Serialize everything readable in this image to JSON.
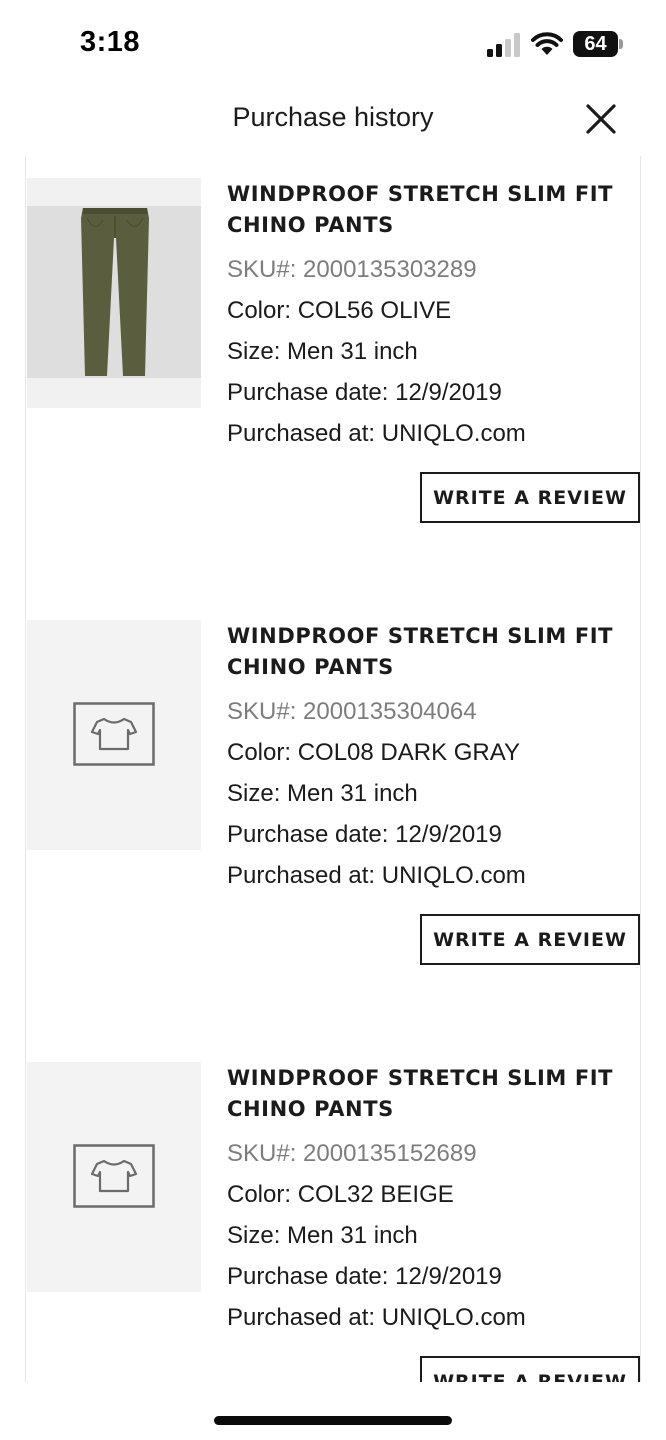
{
  "status_bar": {
    "time": "3:18",
    "battery": "64",
    "icons": [
      "signal-icon",
      "wifi-icon",
      "battery-icon"
    ]
  },
  "header": {
    "title": "Purchase history",
    "close_icon": "close-icon"
  },
  "items": [
    {
      "name": "WINDPROOF STRETCH SLIM FIT CHINO PANTS",
      "sku": "SKU#: 2000135303289",
      "color": "Color: COL56 OLIVE",
      "size": "Size: Men 31 inch",
      "purchase_date": "Purchase date: 12/9/2019",
      "purchased_at": "Purchased at: UNIQLO.com",
      "image": "olive-pants-photo",
      "review_label": "WRITE A REVIEW"
    },
    {
      "name": "WINDPROOF STRETCH SLIM FIT CHINO PANTS",
      "sku": "SKU#: 2000135304064",
      "color": "Color: COL08 DARK GRAY",
      "size": "Size: Men 31 inch",
      "purchase_date": "Purchase date: 12/9/2019",
      "purchased_at": "Purchased at: UNIQLO.com",
      "image": "tshirt-placeholder-icon",
      "review_label": "WRITE A REVIEW"
    },
    {
      "name": "WINDPROOF STRETCH SLIM FIT CHINO PANTS",
      "sku": "SKU#: 2000135152689",
      "color": "Color: COL32 BEIGE",
      "size": "Size: Men 31 inch",
      "purchase_date": "Purchase date: 12/9/2019",
      "purchased_at": "Purchased at: UNIQLO.com",
      "image": "tshirt-placeholder-icon",
      "review_label": "WRITE A REVIEW"
    }
  ],
  "colors": {
    "text": "#1b1b1b",
    "sku_text": "#7d7d7d",
    "thumb_bg": "#f3f3f3",
    "pants_olive": "#5b5d3f"
  }
}
